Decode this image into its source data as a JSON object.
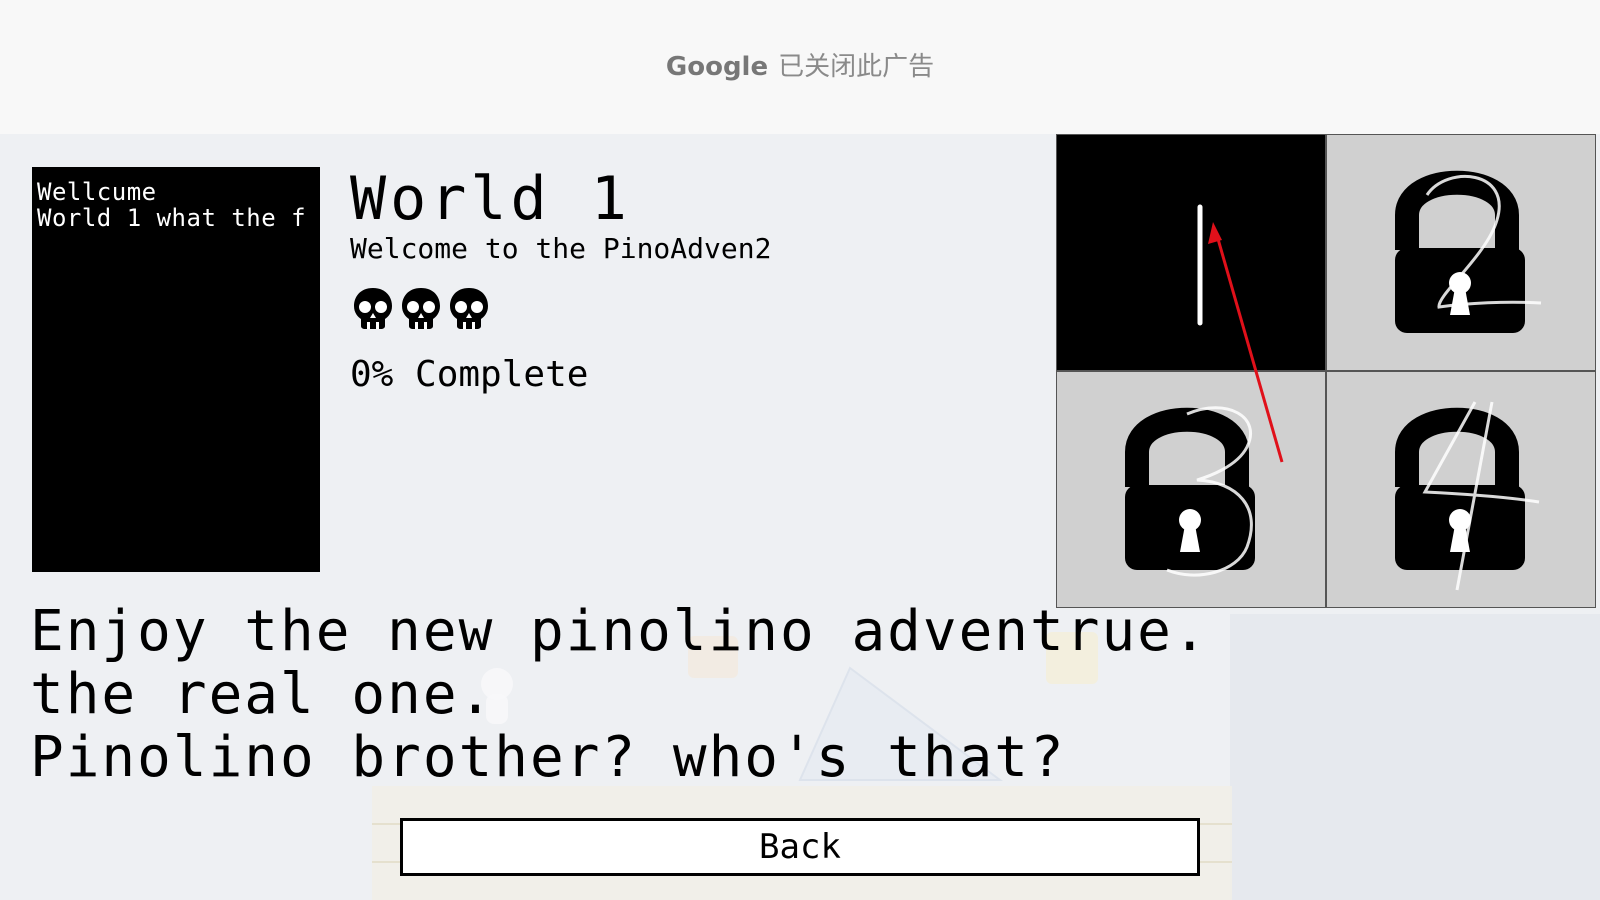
{
  "ad": {
    "brand": "Google",
    "message": "已关闭此广告"
  },
  "preview": {
    "lines": [
      "Wellcume",
      "World 1 what the f"
    ]
  },
  "world": {
    "title": "World 1",
    "subtitle": "Welcome to the PinoAdven2",
    "skull_count": 3,
    "completion": "0% Complete"
  },
  "description": {
    "lines": [
      "Enjoy the new pinolino adventrue.",
      "the real one.",
      "Pinolino brother? who's that?"
    ]
  },
  "levels": [
    {
      "number": "1",
      "status": "unlocked",
      "icon": "level-1-numeral"
    },
    {
      "number": "2",
      "status": "locked",
      "icon": "padlock-icon"
    },
    {
      "number": "3",
      "status": "locked",
      "icon": "padlock-icon"
    },
    {
      "number": "4",
      "status": "locked",
      "icon": "padlock-icon"
    }
  ],
  "back_button": {
    "label": "Back"
  },
  "colors": {
    "unlocked_tile": "#000000",
    "locked_tile": "#d0d0d0",
    "annotation_arrow": "#e0101a"
  }
}
